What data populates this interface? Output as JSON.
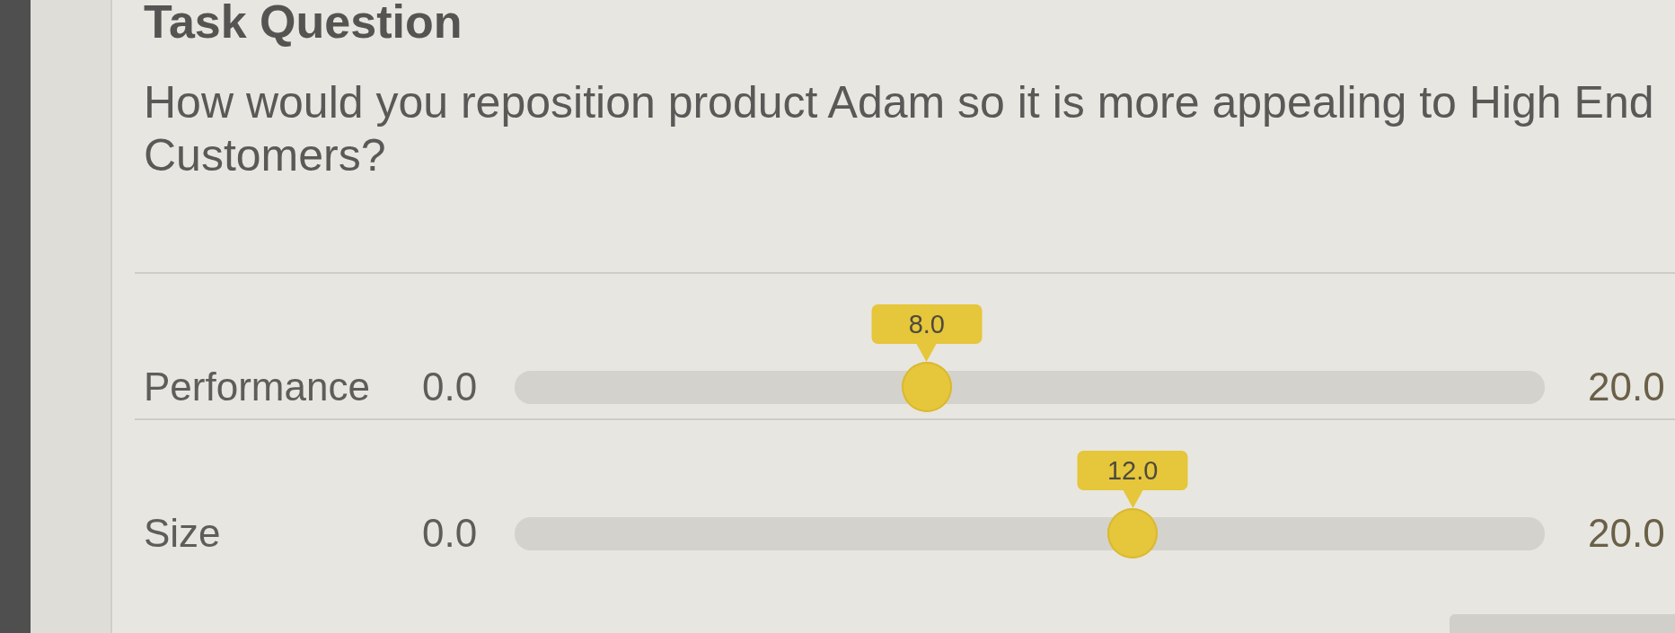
{
  "title": "Task Question",
  "question": "How would you reposition product Adam so it is more appealing to High End Customers?",
  "sliders": [
    {
      "label": "Performance",
      "min": "0.0",
      "max": "20.0",
      "value": "8.0",
      "level": 0.4
    },
    {
      "label": "Size",
      "min": "0.0",
      "max": "20.0",
      "value": "12.0",
      "level": 0.6
    }
  ]
}
